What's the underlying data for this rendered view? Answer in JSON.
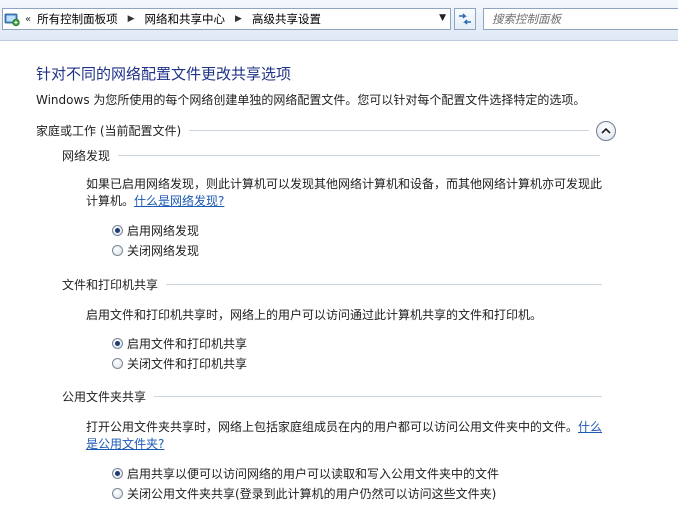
{
  "address_bar": {
    "overflow_chevrons": "«",
    "breadcrumbs": [
      "所有控制面板项",
      "网络和共享中心",
      "高级共享设置"
    ]
  },
  "search": {
    "placeholder": "搜索控制面板"
  },
  "page": {
    "title": "针对不同的网络配置文件更改共享选项",
    "description": "Windows 为您所使用的每个网络创建单独的网络配置文件。您可以针对每个配置文件选择特定的选项。"
  },
  "profile": {
    "label": "家庭或工作 (当前配置文件)"
  },
  "sections": [
    {
      "heading": "网络发现",
      "text": "如果已启用网络发现，则此计算机可以发现其他网络计算机和设备，而其他网络计算机亦可发现此计算机。",
      "link": "什么是网络发现?",
      "options": [
        {
          "label": "启用网络发现",
          "checked": true
        },
        {
          "label": "关闭网络发现",
          "checked": false
        }
      ]
    },
    {
      "heading": "文件和打印机共享",
      "text": "启用文件和打印机共享时，网络上的用户可以访问通过此计算机共享的文件和打印机。",
      "link": "",
      "options": [
        {
          "label": "启用文件和打印机共享",
          "checked": true
        },
        {
          "label": "关闭文件和打印机共享",
          "checked": false
        }
      ]
    },
    {
      "heading": "公用文件夹共享",
      "text": "打开公用文件夹共享时，网络上包括家庭组成员在内的用户都可以访问公用文件夹中的文件。",
      "link": "什么是公用文件夹?",
      "options": [
        {
          "label": "启用共享以便可以访问网络的用户可以读取和写入公用文件夹中的文件",
          "checked": true
        },
        {
          "label": "关闭公用文件夹共享(登录到此计算机的用户仍然可以访问这些文件夹)",
          "checked": false
        }
      ]
    }
  ],
  "icons": {
    "address": "control-panel-icon",
    "breadcrumb_separator": "arrow-right-icon",
    "dropdown": "chevron-down-icon",
    "refresh": "refresh-icon",
    "collapse": "chevron-up-icon"
  },
  "colors": {
    "title": "#1e3287",
    "link": "#1c59b5"
  }
}
